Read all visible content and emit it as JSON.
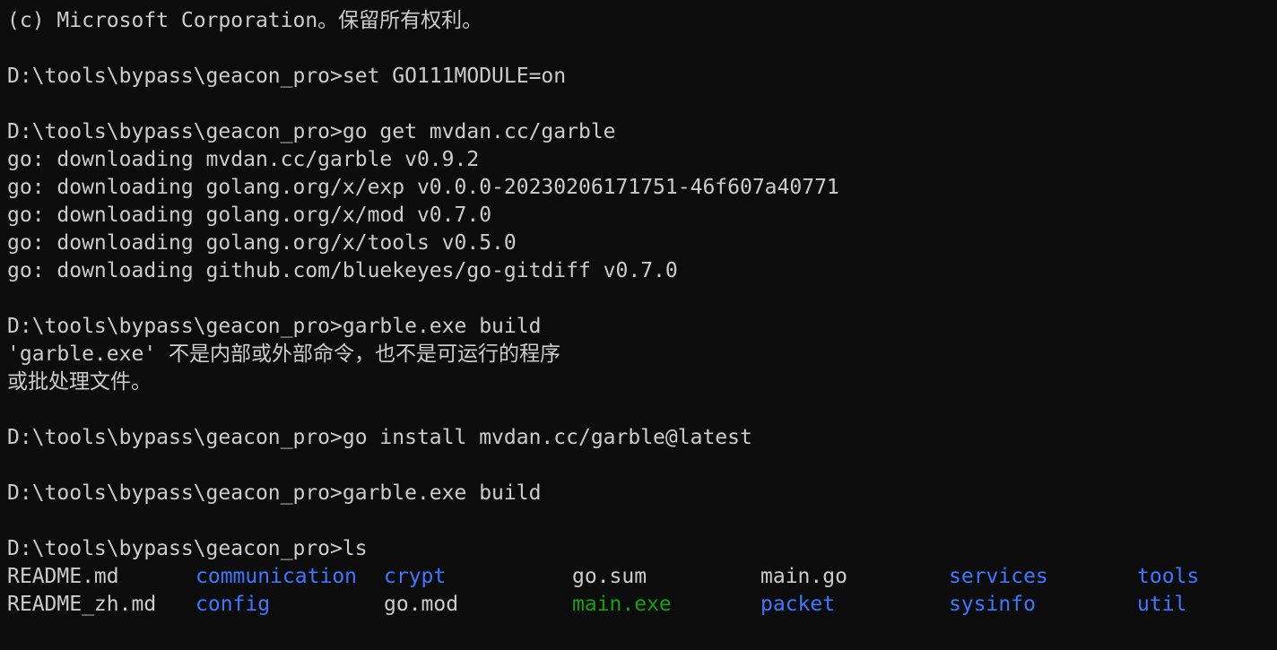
{
  "colors": {
    "background": "#0c0c0c",
    "text": "#cccccc",
    "directory": "#3b78ff",
    "executable": "#13a10e"
  },
  "terminal": {
    "copyright": "(c) Microsoft Corporation。保留所有权利。",
    "cmd_set": "D:\\tools\\bypass\\geacon_pro>set GO111MODULE=on",
    "cmd_goget": "D:\\tools\\bypass\\geacon_pro>go get mvdan.cc/garble",
    "downloads": [
      "go: downloading mvdan.cc/garble v0.9.2",
      "go: downloading golang.org/x/exp v0.0.0-20230206171751-46f607a40771",
      "go: downloading golang.org/x/mod v0.7.0",
      "go: downloading golang.org/x/tools v0.5.0",
      "go: downloading github.com/bluekeyes/go-gitdiff v0.7.0"
    ],
    "cmd_build1": "D:\\tools\\bypass\\geacon_pro>garble.exe build",
    "error_line1": "'garble.exe' 不是内部或外部命令，也不是可运行的程序",
    "error_line2": "或批处理文件。",
    "cmd_install": "D:\\tools\\bypass\\geacon_pro>go install mvdan.cc/garble@latest",
    "cmd_build2": "D:\\tools\\bypass\\geacon_pro>garble.exe build",
    "cmd_ls": "D:\\tools\\bypass\\geacon_pro>ls",
    "ls_rows": [
      [
        {
          "name": "README.md",
          "type": "file"
        },
        {
          "name": "communication",
          "type": "dir"
        },
        {
          "name": "crypt",
          "type": "dir"
        },
        {
          "name": "go.sum",
          "type": "file"
        },
        {
          "name": "main.go",
          "type": "file"
        },
        {
          "name": "services",
          "type": "dir"
        },
        {
          "name": "tools",
          "type": "dir"
        }
      ],
      [
        {
          "name": "README_zh.md",
          "type": "file"
        },
        {
          "name": "config",
          "type": "dir"
        },
        {
          "name": "go.mod",
          "type": "file"
        },
        {
          "name": "main.exe",
          "type": "exe"
        },
        {
          "name": "packet",
          "type": "dir"
        },
        {
          "name": "sysinfo",
          "type": "dir"
        },
        {
          "name": "util",
          "type": "dir"
        }
      ]
    ]
  }
}
